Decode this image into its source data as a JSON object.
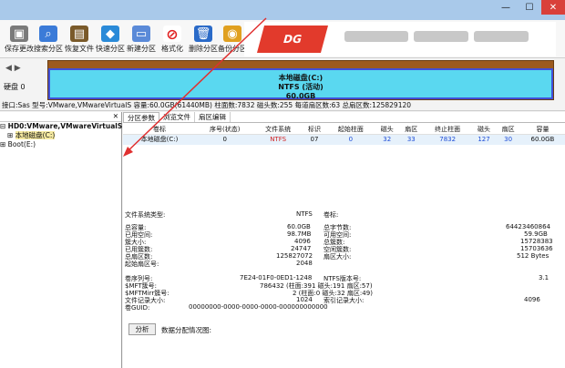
{
  "toolbar": {
    "buttons": [
      {
        "label": "保存更改",
        "icon": "save-icon"
      },
      {
        "label": "搜索分区",
        "icon": "search-icon"
      },
      {
        "label": "恢复文件",
        "icon": "recover-file-icon"
      },
      {
        "label": "快速分区",
        "icon": "quick-partition-icon"
      },
      {
        "label": "新建分区",
        "icon": "new-partition-icon"
      },
      {
        "label": "格式化",
        "icon": "format-icon"
      },
      {
        "label": "删除分区",
        "icon": "delete-partition-icon"
      },
      {
        "label": "备份分区",
        "icon": "backup-partition-icon"
      }
    ]
  },
  "disk": {
    "label": "硬盘 0",
    "partition_line1": "本地磁盘(C:)",
    "partition_line2": "NTFS (活动)",
    "partition_line3": "60.0GB",
    "info": "接口:Sas  型号:VMware,VMwareVirtualS  容量:60.0GB(61440MB)  柱面数:7832  磁头数:255  每道扇区数:63  总扇区数:125829120"
  },
  "tree": {
    "root": "HD0:VMware,VMwareVirtualS",
    "child": "本地磁盘(C:)",
    "boot": "Boot(E:)"
  },
  "tabs": [
    "分区参数",
    "浏览文件",
    "扇区编辑"
  ],
  "ptable": {
    "headers": [
      "卷标",
      "序号(状态)",
      "文件系统",
      "标识",
      "起始柱面",
      "磁头",
      "扇区",
      "终止柱面",
      "磁头",
      "扇区",
      "容量"
    ],
    "row": [
      "本地磁盘(C:)",
      "0",
      "NTFS",
      "07",
      "0",
      "32",
      "33",
      "7832",
      "127",
      "30",
      "60.0GB"
    ]
  },
  "details": {
    "fs_type_label": "文件系统类型:",
    "fs_type": "NTFS",
    "vol_label": "卷标:",
    "left": [
      [
        "总容量:",
        "60.0GB"
      ],
      [
        "已用空间:",
        "98.7MB"
      ],
      [
        "簇大小:",
        "4096"
      ],
      [
        "已用簇数:",
        "24747"
      ],
      [
        "总扇区数:",
        "125827072"
      ],
      [
        "起始扇区号:",
        "2048"
      ]
    ],
    "right": [
      [
        "总字节数:",
        "64423460864"
      ],
      [
        "可用空间:",
        "59.9GB"
      ],
      [
        "总簇数:",
        "15728383"
      ],
      [
        "空闲簇数:",
        "15703636"
      ],
      [
        "扇区大小:",
        "512 Bytes"
      ]
    ],
    "serial_label": "卷序列号:",
    "serial": "7E24-01F0-0ED1-1248",
    "ntfs_ver_label": "NTFS版本号:",
    "ntfs_ver": "3.1",
    "mft_label": "$MFT簇号:",
    "mft": "786432 (柱面:391 磁头:191 扇区:57)",
    "mftmirr_label": "$MFTMirr簇号:",
    "mftmirr": "2 (柱面:0 磁头:32 扇区:49)",
    "rec_label": "文件记录大小:",
    "rec": "1024",
    "idx_label": "索引记录大小:",
    "idx": "4096",
    "guid_label": "卷GUID:",
    "guid": "00000000-0000-0000-0000-000000000000"
  },
  "analyze_button": "分析",
  "analyze_label": "数据分配情况图:",
  "colors": {
    "partition_fill": "#5ad8f0",
    "disk_bar": "#9c5a1f",
    "title_bar": "#a9c9ea",
    "annotation_arrow": "#e03030"
  }
}
